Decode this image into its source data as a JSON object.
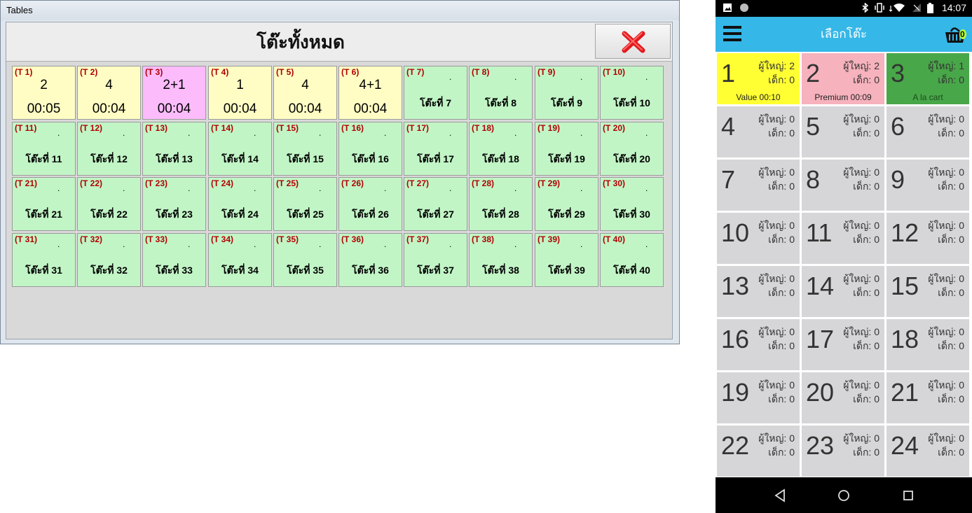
{
  "window": {
    "title": "Tables",
    "header_title": "โต๊ะทั้งหมด",
    "close_icon": "close-icon",
    "accent_close": "#e2191c"
  },
  "tables": [
    {
      "label": "(T 1)",
      "status": "occupied",
      "guests": "2",
      "time": "00:05"
    },
    {
      "label": "(T 2)",
      "status": "occupied",
      "guests": "4",
      "time": "00:04"
    },
    {
      "label": "(T 3)",
      "status": "occupied-extra",
      "guests": "2+1",
      "time": "00:04"
    },
    {
      "label": "(T 4)",
      "status": "occupied",
      "guests": "1",
      "time": "00:04"
    },
    {
      "label": "(T 5)",
      "status": "occupied",
      "guests": "4",
      "time": "00:04"
    },
    {
      "label": "(T 6)",
      "status": "occupied",
      "guests": "4+1",
      "time": "00:04"
    },
    {
      "label": "(T 7)",
      "status": "free",
      "name": "โต๊ะที่ 7"
    },
    {
      "label": "(T 8)",
      "status": "free",
      "name": "โต๊ะที่ 8"
    },
    {
      "label": "(T 9)",
      "status": "free",
      "name": "โต๊ะที่ 9"
    },
    {
      "label": "(T 10)",
      "status": "free",
      "name": "โต๊ะที่ 10"
    },
    {
      "label": "(T 11)",
      "status": "free",
      "name": "โต๊ะที่ 11"
    },
    {
      "label": "(T 12)",
      "status": "free",
      "name": "โต๊ะที่ 12"
    },
    {
      "label": "(T 13)",
      "status": "free",
      "name": "โต๊ะที่ 13"
    },
    {
      "label": "(T 14)",
      "status": "free",
      "name": "โต๊ะที่ 14"
    },
    {
      "label": "(T 15)",
      "status": "free",
      "name": "โต๊ะที่ 15"
    },
    {
      "label": "(T 16)",
      "status": "free",
      "name": "โต๊ะที่ 16"
    },
    {
      "label": "(T 17)",
      "status": "free",
      "name": "โต๊ะที่ 17"
    },
    {
      "label": "(T 18)",
      "status": "free",
      "name": "โต๊ะที่ 18"
    },
    {
      "label": "(T 19)",
      "status": "free",
      "name": "โต๊ะที่ 19"
    },
    {
      "label": "(T 20)",
      "status": "free",
      "name": "โต๊ะที่ 20"
    },
    {
      "label": "(T 21)",
      "status": "free",
      "name": "โต๊ะที่ 21"
    },
    {
      "label": "(T 22)",
      "status": "free",
      "name": "โต๊ะที่ 22"
    },
    {
      "label": "(T 23)",
      "status": "free",
      "name": "โต๊ะที่ 23"
    },
    {
      "label": "(T 24)",
      "status": "free",
      "name": "โต๊ะที่ 24"
    },
    {
      "label": "(T 25)",
      "status": "free",
      "name": "โต๊ะที่ 25"
    },
    {
      "label": "(T 26)",
      "status": "free",
      "name": "โต๊ะที่ 26"
    },
    {
      "label": "(T 27)",
      "status": "free",
      "name": "โต๊ะที่ 27"
    },
    {
      "label": "(T 28)",
      "status": "free",
      "name": "โต๊ะที่ 28"
    },
    {
      "label": "(T 29)",
      "status": "free",
      "name": "โต๊ะที่ 29"
    },
    {
      "label": "(T 30)",
      "status": "free",
      "name": "โต๊ะที่ 30"
    },
    {
      "label": "(T 31)",
      "status": "free",
      "name": "โต๊ะที่ 31"
    },
    {
      "label": "(T 32)",
      "status": "free",
      "name": "โต๊ะที่ 32"
    },
    {
      "label": "(T 33)",
      "status": "free",
      "name": "โต๊ะที่ 33"
    },
    {
      "label": "(T 34)",
      "status": "free",
      "name": "โต๊ะที่ 34"
    },
    {
      "label": "(T 35)",
      "status": "free",
      "name": "โต๊ะที่ 35"
    },
    {
      "label": "(T 36)",
      "status": "free",
      "name": "โต๊ะที่ 36"
    },
    {
      "label": "(T 37)",
      "status": "free",
      "name": "โต๊ะที่ 37"
    },
    {
      "label": "(T 38)",
      "status": "free",
      "name": "โต๊ะที่ 38"
    },
    {
      "label": "(T 39)",
      "status": "free",
      "name": "โต๊ะที่ 39"
    },
    {
      "label": "(T 40)",
      "status": "free",
      "name": "โต๊ะที่ 40"
    }
  ],
  "table_colors": {
    "free": "#c2f5c6",
    "occupied": "#fffdc4",
    "occupied-extra": "#fcbcfc"
  },
  "phone": {
    "status_time": "14:07",
    "app_title": "เลือกโต๊ะ",
    "cart_count": "0",
    "menu_icon": "hamburger-menu-icon",
    "cart_icon": "basket-icon",
    "tiles": [
      {
        "num": "1",
        "adult": "ผู้ใหญ่: 2",
        "child": "เด็ก: 0",
        "pkg": "Value 00:10",
        "color": "yellow"
      },
      {
        "num": "2",
        "adult": "ผู้ใหญ่: 2",
        "child": "เด็ก: 0",
        "pkg": "Premium 00:09",
        "color": "pink"
      },
      {
        "num": "3",
        "adult": "ผู้ใหญ่: 1",
        "child": "เด็ก: 0",
        "pkg": "A la cart",
        "color": "green"
      },
      {
        "num": "4",
        "adult": "ผู้ใหญ่: 0",
        "child": "เด็ก: 0"
      },
      {
        "num": "5",
        "adult": "ผู้ใหญ่: 0",
        "child": "เด็ก: 0"
      },
      {
        "num": "6",
        "adult": "ผู้ใหญ่: 0",
        "child": "เด็ก: 0"
      },
      {
        "num": "7",
        "adult": "ผู้ใหญ่: 0",
        "child": "เด็ก: 0"
      },
      {
        "num": "8",
        "adult": "ผู้ใหญ่: 0",
        "child": "เด็ก: 0"
      },
      {
        "num": "9",
        "adult": "ผู้ใหญ่: 0",
        "child": "เด็ก: 0"
      },
      {
        "num": "10",
        "adult": "ผู้ใหญ่: 0",
        "child": "เด็ก: 0"
      },
      {
        "num": "11",
        "adult": "ผู้ใหญ่: 0",
        "child": "เด็ก: 0"
      },
      {
        "num": "12",
        "adult": "ผู้ใหญ่: 0",
        "child": "เด็ก: 0"
      },
      {
        "num": "13",
        "adult": "ผู้ใหญ่: 0",
        "child": "เด็ก: 0"
      },
      {
        "num": "14",
        "adult": "ผู้ใหญ่: 0",
        "child": "เด็ก: 0"
      },
      {
        "num": "15",
        "adult": "ผู้ใหญ่: 0",
        "child": "เด็ก: 0"
      },
      {
        "num": "16",
        "adult": "ผู้ใหญ่: 0",
        "child": "เด็ก: 0"
      },
      {
        "num": "17",
        "adult": "ผู้ใหญ่: 0",
        "child": "เด็ก: 0"
      },
      {
        "num": "18",
        "adult": "ผู้ใหญ่: 0",
        "child": "เด็ก: 0"
      },
      {
        "num": "19",
        "adult": "ผู้ใหญ่: 0",
        "child": "เด็ก: 0"
      },
      {
        "num": "20",
        "adult": "ผู้ใหญ่: 0",
        "child": "เด็ก: 0"
      },
      {
        "num": "21",
        "adult": "ผู้ใหญ่: 0",
        "child": "เด็ก: 0"
      },
      {
        "num": "22",
        "adult": "ผู้ใหญ่: 0",
        "child": "เด็ก: 0"
      },
      {
        "num": "23",
        "adult": "ผู้ใหญ่: 0",
        "child": "เด็ก: 0"
      },
      {
        "num": "24",
        "adult": "ผู้ใหญ่: 0",
        "child": "เด็ก: 0"
      }
    ],
    "tile_colors": {
      "default": "#d6d6d8",
      "yellow": "#ffff33",
      "pink": "#f6b2bd",
      "green": "#48a748"
    },
    "accent": "#35b7e8",
    "nav_icons": [
      "back-icon",
      "home-icon",
      "recents-icon"
    ]
  }
}
